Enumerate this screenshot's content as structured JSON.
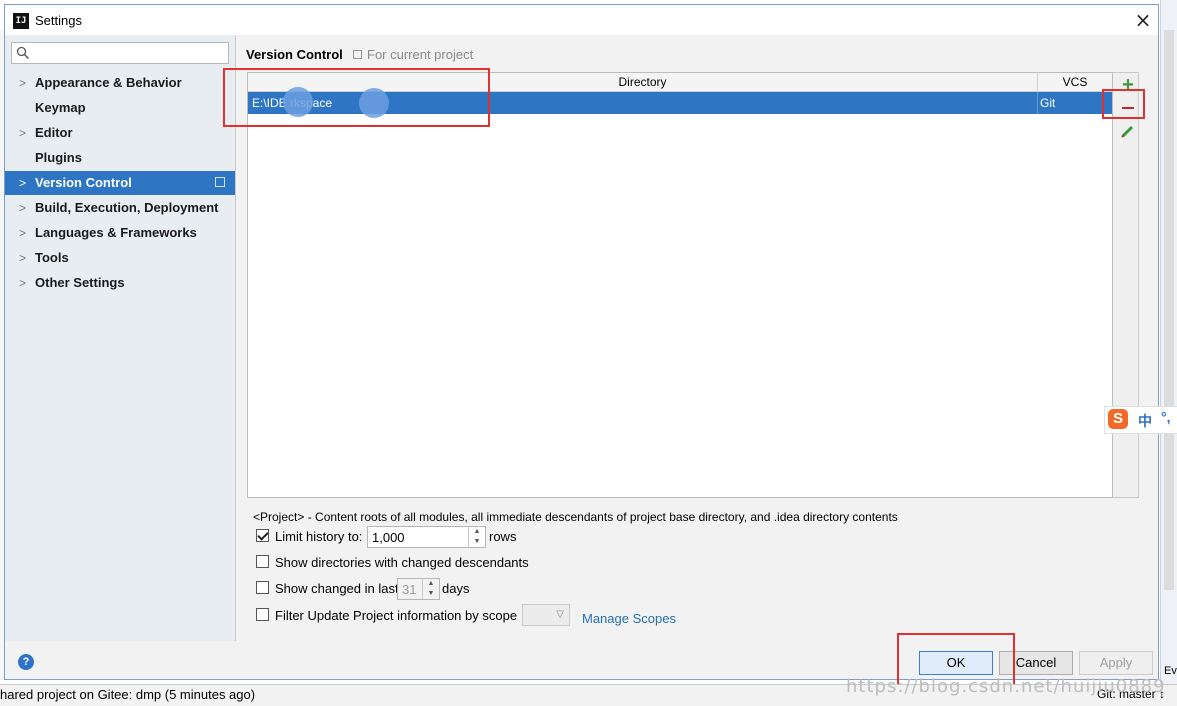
{
  "window": {
    "title": "Settings",
    "icon_text": "IJ"
  },
  "sidebar": {
    "search_placeholder": "",
    "items": [
      {
        "label": "Appearance & Behavior",
        "expandable": true
      },
      {
        "label": "Keymap",
        "expandable": false
      },
      {
        "label": "Editor",
        "expandable": true
      },
      {
        "label": "Plugins",
        "expandable": false
      },
      {
        "label": "Version Control",
        "expandable": true,
        "selected": true
      },
      {
        "label": "Build, Execution, Deployment",
        "expandable": true
      },
      {
        "label": "Languages & Frameworks",
        "expandable": true
      },
      {
        "label": "Tools",
        "expandable": true
      },
      {
        "label": "Other Settings",
        "expandable": true
      }
    ]
  },
  "main": {
    "title": "Version Control",
    "scope_note": "For current project",
    "table": {
      "columns": [
        "Directory",
        "VCS"
      ],
      "rows": [
        {
          "directory": "E:\\IDE      rkspace",
          "vcs": "Git"
        }
      ]
    },
    "description": "<Project> - Content roots of all modules, all immediate descendants of project base directory, and .idea directory contents",
    "options": {
      "limit_history": {
        "label": "Limit history to:",
        "checked": true,
        "value": "1,000",
        "suffix": "rows"
      },
      "show_changed_descendants": {
        "label": "Show directories with changed descendants",
        "checked": false
      },
      "show_changed_last": {
        "label": "Show changed in last",
        "checked": false,
        "value": "31",
        "suffix": "days"
      },
      "filter_update": {
        "label": "Filter Update Project information by scope",
        "checked": false,
        "scope_value": ""
      }
    },
    "manage_scopes": "Manage Scopes"
  },
  "buttons": {
    "ok": "OK",
    "cancel": "Cancel",
    "apply": "Apply",
    "help": "?"
  },
  "status_bar": {
    "message": "hared project on Gitee: dmp (5 minutes ago)",
    "git_branch": "Git: master ↕"
  },
  "watermark": "https://blog.csdn.net/huijiu0889",
  "ime": {
    "zh": "中",
    "punct": "°,"
  },
  "side_tab": "Ev",
  "colors": {
    "selection": "#2e76c4",
    "highlight_box": "#e03131",
    "add": "#3a9b3a",
    "remove": "#c62828",
    "link": "#2470b3"
  }
}
